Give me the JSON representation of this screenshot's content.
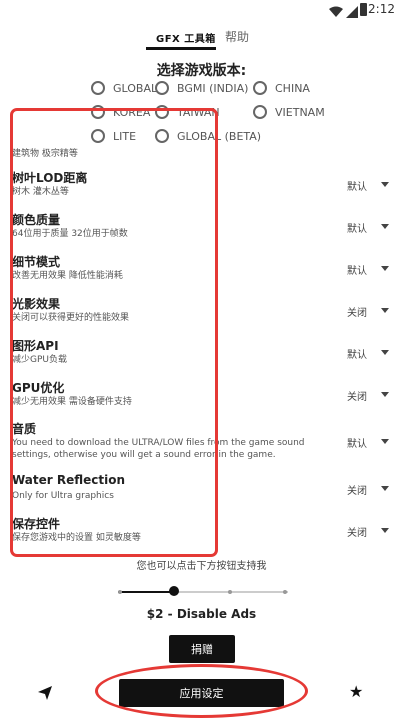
{
  "status_bar": {
    "time": "2:12"
  },
  "tabs": [
    {
      "label": "GFX 工具箱",
      "active": true
    },
    {
      "label": "帮助",
      "active": false
    }
  ],
  "version_section": {
    "title": "选择游戏版本:",
    "options": [
      "GLOBAL",
      "BGMI (INDIA)",
      "CHINA",
      "KOREA",
      "TAIWAN",
      "VIETNAM",
      "LITE",
      "GLOBAL (BETA)"
    ]
  },
  "partial_text": "建筑物 极宗精等",
  "settings": [
    {
      "title": "树叶LOD距离",
      "desc": "树木 灌木丛等",
      "value": "默认"
    },
    {
      "title": "颜色质量",
      "desc": "64位用于质量 32位用于帧数",
      "value": "默认"
    },
    {
      "title": "细节模式",
      "desc": "改善无用效果 降低性能消耗",
      "value": "默认"
    },
    {
      "title": "光影效果",
      "desc": "关闭可以获得更好的性能效果",
      "value": "关闭"
    },
    {
      "title": "图形API",
      "desc": "减少GPU负载",
      "value": "默认"
    },
    {
      "title": "GPU优化",
      "desc": "减少无用效果 需设备硬件支持",
      "value": "关闭"
    },
    {
      "title": "音质",
      "desc": "You need to download the ULTRA/LOW files from the game sound settings, otherwise you will get a sound error in the game.",
      "value": "默认"
    },
    {
      "title": "Water Reflection",
      "desc": "Only for Ultra graphics",
      "value": "关闭"
    },
    {
      "title": "保存控件",
      "desc": "保存您游戏中的设置 如灵敏度等",
      "value": "关闭"
    }
  ],
  "support_text": "您也可以点击下方按钮支持我",
  "donation_slider": {
    "level_fraction": 0.33,
    "steps": 4
  },
  "price_label": "$2 - Disable Ads",
  "donate_button": "捐赠",
  "apply_button": "应用设定",
  "icons": [
    "wifi-icon",
    "signal-icon",
    "battery-icon",
    "send-icon",
    "star-icon",
    "caret-down-icon"
  ]
}
